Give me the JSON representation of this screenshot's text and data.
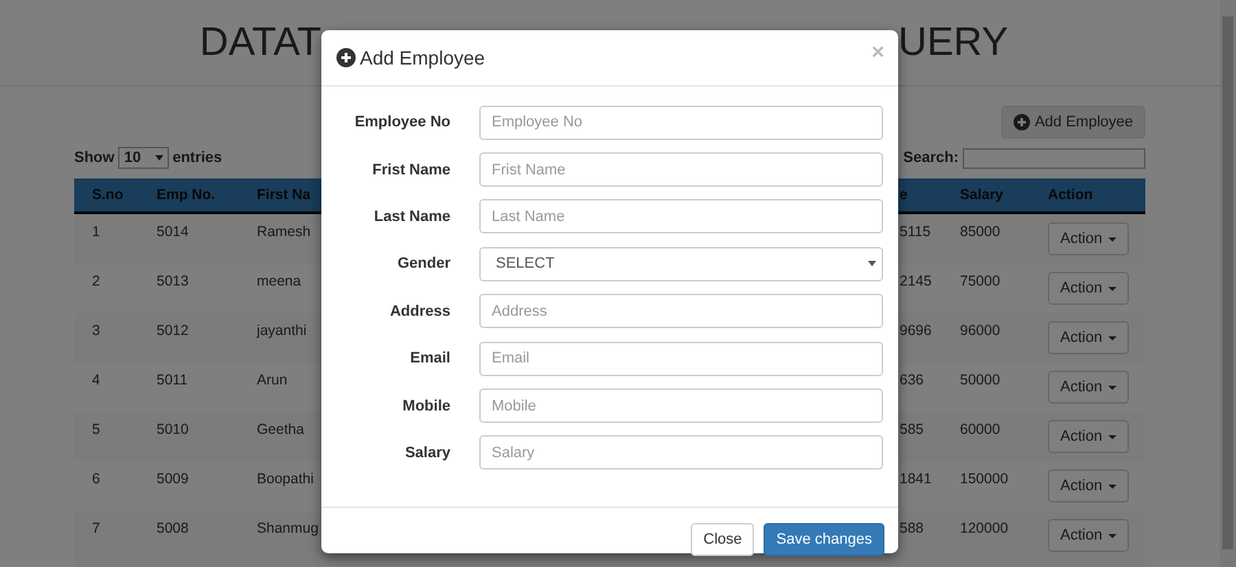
{
  "page": {
    "title_left": "DATAT",
    "title_right": "UERY",
    "add_button": "Add Employee",
    "length": {
      "label_before": "Show",
      "value": "10",
      "label_after": "entries"
    },
    "search": {
      "label": "Search:"
    }
  },
  "table": {
    "columns": [
      "S.no",
      "Emp No.",
      "First Na",
      "e",
      "Salary",
      "Action"
    ],
    "rows": [
      {
        "cells": [
          "1",
          "5014",
          "Ramesh",
          "5115",
          "85000"
        ],
        "action": "Action"
      },
      {
        "cells": [
          "2",
          "5013",
          "meena",
          "2145",
          "75000"
        ],
        "action": "Action"
      },
      {
        "cells": [
          "3",
          "5012",
          "jayanthi",
          "9696",
          "96000"
        ],
        "action": "Action"
      },
      {
        "cells": [
          "4",
          "5011",
          "Arun",
          "636",
          "50000"
        ],
        "action": "Action"
      },
      {
        "cells": [
          "5",
          "5010",
          "Geetha",
          "585",
          "60000"
        ],
        "action": "Action"
      },
      {
        "cells": [
          "6",
          "5009",
          "Boopathi",
          "1841",
          "150000"
        ],
        "action": "Action"
      },
      {
        "cells": [
          "7",
          "5008",
          "Shanmug",
          "588",
          "120000"
        ],
        "action": "Action"
      }
    ]
  },
  "modal": {
    "title": "Add Employee",
    "close": "×",
    "fields": [
      {
        "label": "Employee No",
        "kind": "text",
        "placeholder": "Employee No"
      },
      {
        "label": "Frist Name",
        "kind": "text",
        "placeholder": "Frist Name"
      },
      {
        "label": "Last Name",
        "kind": "text",
        "placeholder": "Last Name"
      },
      {
        "label": "Gender",
        "kind": "select",
        "value": "SELECT"
      },
      {
        "label": "Address",
        "kind": "text",
        "placeholder": "Address"
      },
      {
        "label": "Email",
        "kind": "text",
        "placeholder": "Email"
      },
      {
        "label": "Mobile",
        "kind": "text",
        "placeholder": "Mobile"
      },
      {
        "label": "Salary",
        "kind": "text",
        "placeholder": "Salary"
      }
    ],
    "buttons": [
      {
        "label": "Close",
        "kind": "default"
      },
      {
        "label": "Save changes",
        "kind": "primary"
      }
    ]
  }
}
